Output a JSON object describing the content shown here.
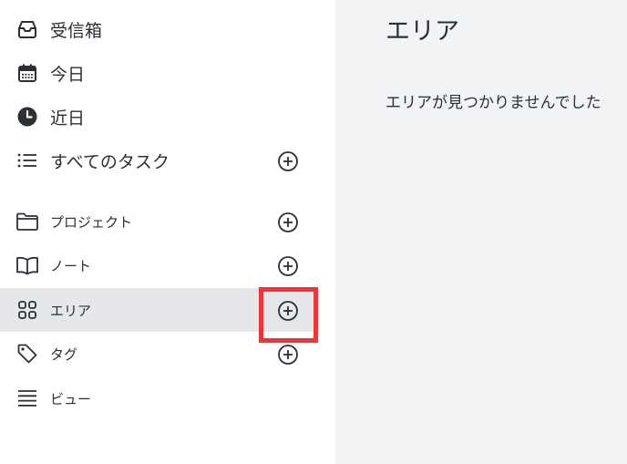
{
  "sidebar": {
    "primary": [
      {
        "label": "受信箱",
        "icon": "inbox-icon"
      },
      {
        "label": "今日",
        "icon": "calendar-icon"
      },
      {
        "label": "近日",
        "icon": "clock-icon"
      },
      {
        "label": "すべてのタスク",
        "icon": "list-icon",
        "has_add": true
      }
    ],
    "secondary": [
      {
        "label": "プロジェクト",
        "icon": "folder-icon",
        "has_add": true
      },
      {
        "label": "ノート",
        "icon": "book-icon",
        "has_add": true
      },
      {
        "label": "エリア",
        "icon": "grid-icon",
        "has_add": true,
        "active": true
      },
      {
        "label": "タグ",
        "icon": "tag-icon",
        "has_add": true
      },
      {
        "label": "ビュー",
        "icon": "views-icon"
      }
    ]
  },
  "main": {
    "title": "エリア",
    "empty_message": "エリアが見つかりませんでした"
  },
  "colors": {
    "main_background": "#f2f3f5",
    "active_row": "#e6e7ea",
    "highlight_border": "#ee3439",
    "text": "#2b2f36"
  }
}
